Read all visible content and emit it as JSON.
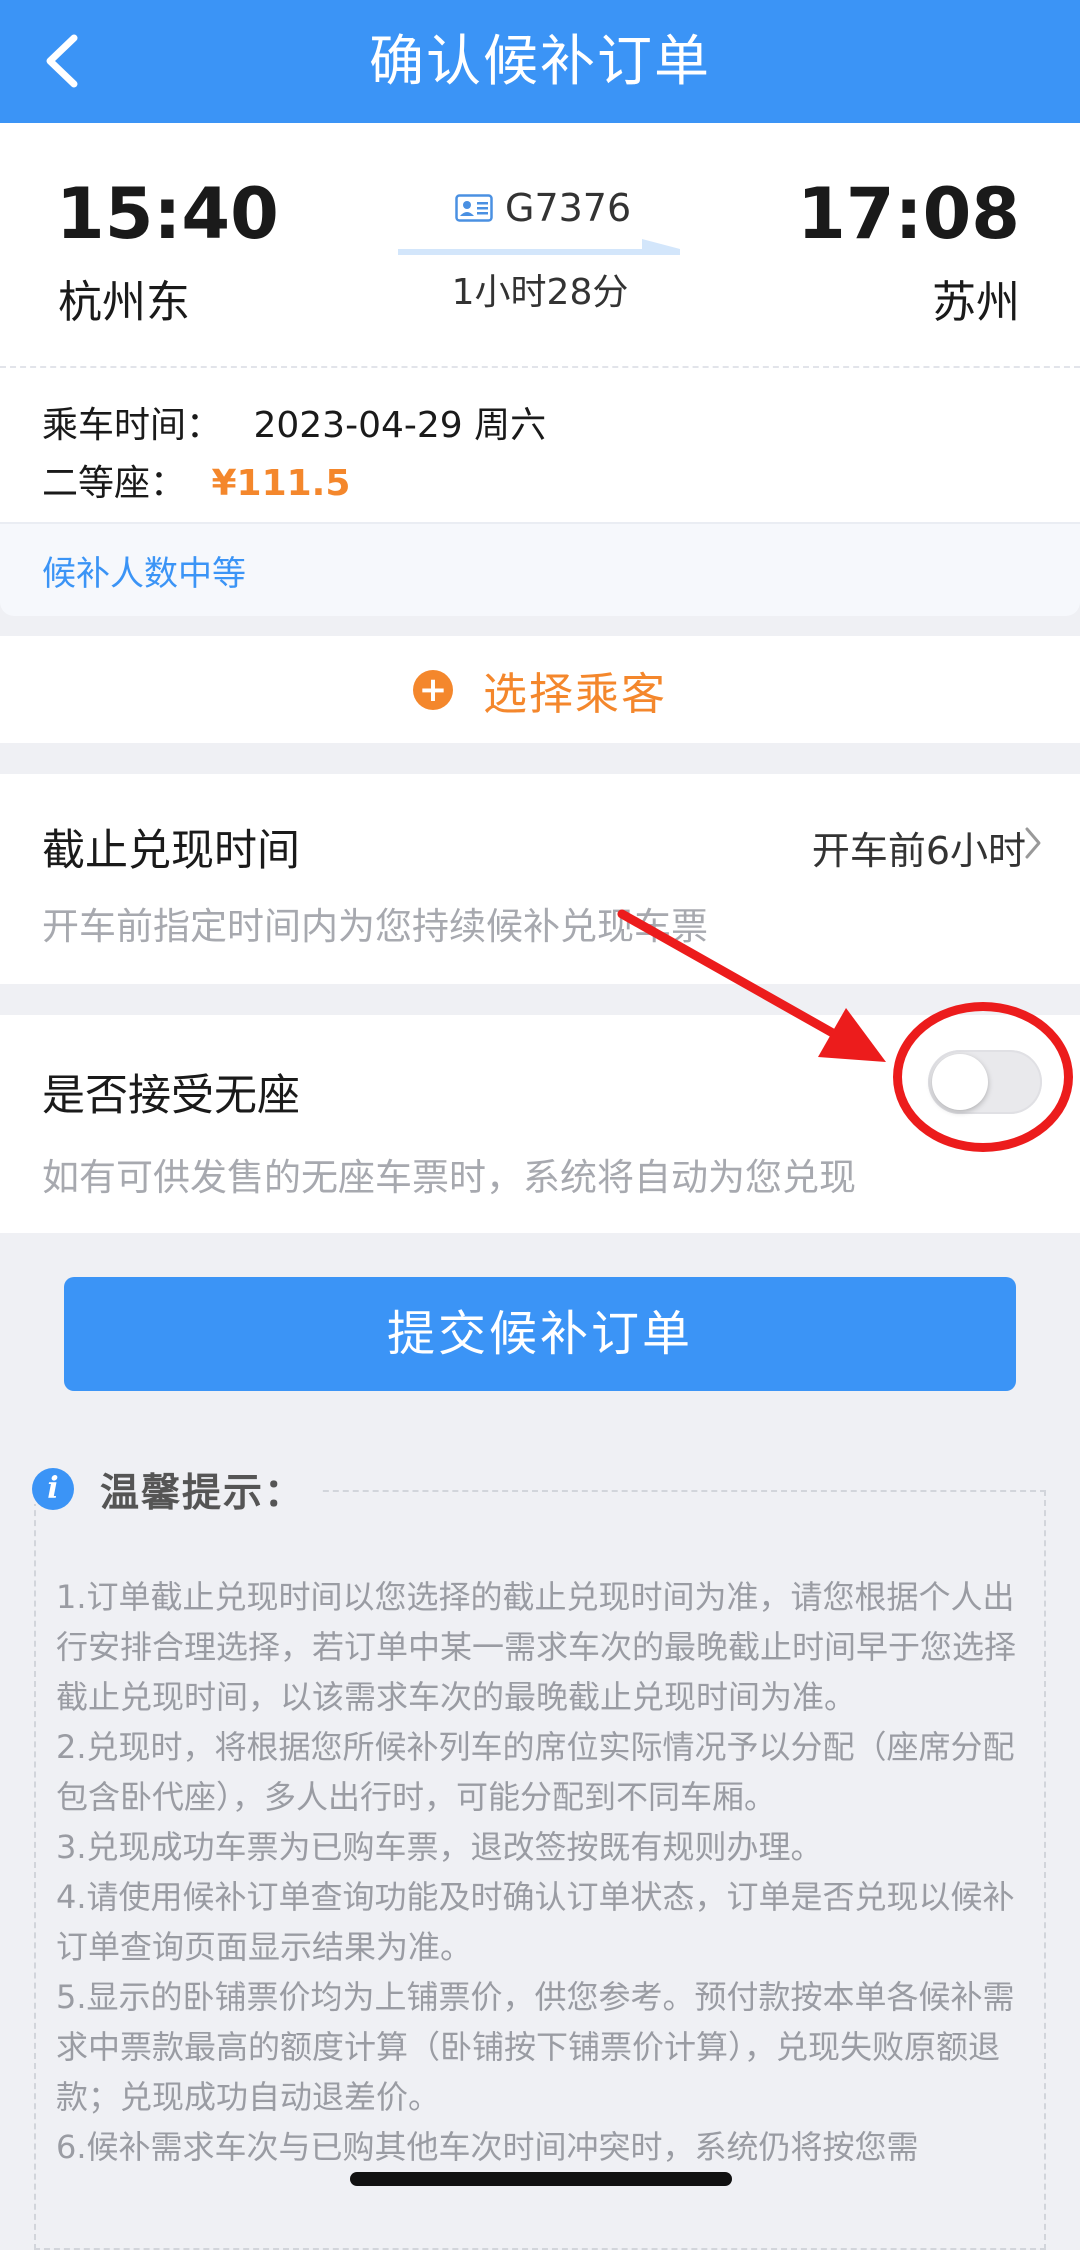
{
  "header": {
    "title": "确认候补订单"
  },
  "train": {
    "depart_time": "15:40",
    "depart_station": "杭州东",
    "arrive_time": "17:08",
    "arrive_station": "苏州",
    "number": "G7376",
    "duration": "1小时28分"
  },
  "info": {
    "date_label": "乘车时间：",
    "date_value": "2023-04-29 周六",
    "seat_label": "二等座：",
    "seat_price": "¥111.5",
    "waitlist_level": "候补人数中等"
  },
  "passenger": {
    "add_label": "选择乘客"
  },
  "deadline": {
    "title": "截止兑现时间",
    "value": "开车前6小时",
    "sub": "开车前指定时间内为您持续候补兑现车票"
  },
  "standing": {
    "title": "是否接受无座",
    "sub": "如有可供发售的无座车票时，系统将自动为您兑现",
    "enabled": false
  },
  "submit": {
    "label": "提交候补订单"
  },
  "tips": {
    "title": "温馨提示：",
    "items": [
      "1.订单截止兑现时间以您选择的截止兑现时间为准，请您根据个人出行安排合理选择，若订单中某一需求车次的最晚截止时间早于您选择截止兑现时间，以该需求车次的最晚截止兑现时间为准。",
      "2.兑现时，将根据您所候补列车的席位实际情况予以分配（座席分配包含卧代座），多人出行时，可能分配到不同车厢。",
      "3.兑现成功车票为已购车票，退改签按既有规则办理。",
      "4.请使用候补订单查询功能及时确认订单状态，订单是否兑现以候补订单查询页面显示结果为准。",
      "5.显示的卧铺票价均为上铺票价，供您参考。预付款按本单各候补需求中票款最高的额度计算（卧铺按下铺票价计算），兑现失败原额退款；兑现成功自动退差价。",
      "6.候补需求车次与已购其他车次时间冲突时，系统仍将按您需"
    ]
  },
  "colors": {
    "brand_blue": "#3b94f6",
    "accent_orange": "#f4872c",
    "annotation_red": "#ec1c1c"
  }
}
